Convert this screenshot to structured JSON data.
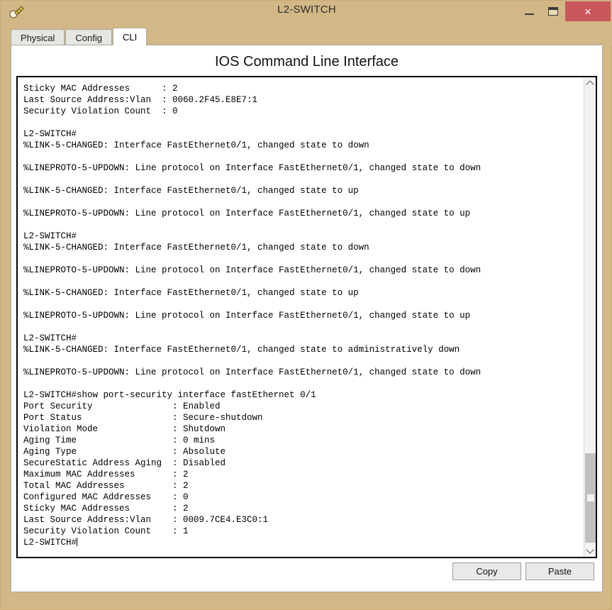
{
  "window": {
    "title": "L2-SWITCH",
    "icon": "packet-tracer-device-icon",
    "controls": {
      "minimize": "minimize-icon",
      "maximize": "maximize-icon",
      "close": "×"
    },
    "colors": {
      "titlebar": "#d2b887",
      "close_button": "#c9575b",
      "client": "#ffffff",
      "terminal_border": "#000000"
    }
  },
  "tabs": [
    {
      "label": "Physical",
      "active": false
    },
    {
      "label": "Config",
      "active": false
    },
    {
      "label": "CLI",
      "active": true
    }
  ],
  "panel": {
    "heading": "IOS Command Line Interface"
  },
  "terminal": {
    "prompt": "L2-SWITCH#",
    "cursor_visible": true,
    "lines": [
      "Sticky MAC Addresses      : 2",
      "Last Source Address:Vlan  : 0060.2F45.E8E7:1",
      "Security Violation Count  : 0",
      "",
      "L2-SWITCH#",
      "%LINK-5-CHANGED: Interface FastEthernet0/1, changed state to down",
      "",
      "%LINEPROTO-5-UPDOWN: Line protocol on Interface FastEthernet0/1, changed state to down",
      "",
      "%LINK-5-CHANGED: Interface FastEthernet0/1, changed state to up",
      "",
      "%LINEPROTO-5-UPDOWN: Line protocol on Interface FastEthernet0/1, changed state to up",
      "",
      "L2-SWITCH#",
      "%LINK-5-CHANGED: Interface FastEthernet0/1, changed state to down",
      "",
      "%LINEPROTO-5-UPDOWN: Line protocol on Interface FastEthernet0/1, changed state to down",
      "",
      "%LINK-5-CHANGED: Interface FastEthernet0/1, changed state to up",
      "",
      "%LINEPROTO-5-UPDOWN: Line protocol on Interface FastEthernet0/1, changed state to up",
      "",
      "L2-SWITCH#",
      "%LINK-5-CHANGED: Interface FastEthernet0/1, changed state to administratively down",
      "",
      "%LINEPROTO-5-UPDOWN: Line protocol on Interface FastEthernet0/1, changed state to down",
      "",
      "L2-SWITCH#show port-security interface fastEthernet 0/1",
      "Port Security               : Enabled",
      "Port Status                 : Secure-shutdown",
      "Violation Mode              : Shutdown",
      "Aging Time                  : 0 mins",
      "Aging Type                  : Absolute",
      "SecureStatic Address Aging  : Disabled",
      "Maximum MAC Addresses       : 2",
      "Total MAC Addresses         : 2",
      "Configured MAC Addresses    : 0",
      "Sticky MAC Addresses        : 2",
      "Last Source Address:Vlan    : 0009.7CE4.E3C0:1",
      "Security Violation Count    : 1",
      ""
    ]
  },
  "scrollbar": {
    "up_arrow": "chevron-up-icon",
    "down_arrow": "chevron-down-icon",
    "thumb_position": "near-bottom"
  },
  "buttons": {
    "copy": "Copy",
    "paste": "Paste"
  }
}
